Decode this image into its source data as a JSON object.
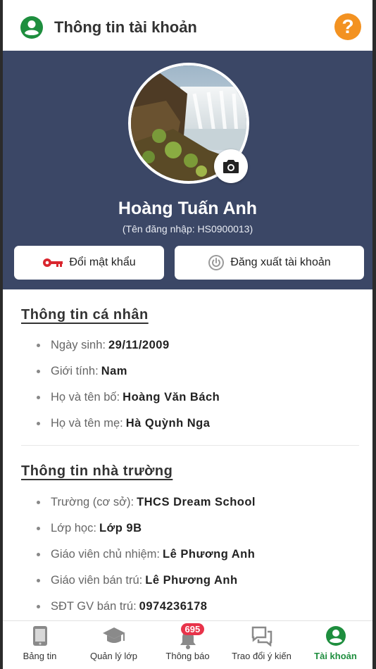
{
  "header": {
    "title": "Thông tin tài khoản",
    "help_symbol": "?",
    "icons": {
      "account": "account-circle-icon",
      "help": "help-icon"
    }
  },
  "profile": {
    "full_name": "Hoàng Tuấn Anh",
    "username_text": "(Tên đăng nhập: HS0900013)",
    "change_password_label": "Đổi mật khẩu",
    "logout_label": "Đăng xuất tài khoản",
    "icons": {
      "camera": "camera-icon",
      "key": "key-icon",
      "power": "power-icon"
    }
  },
  "personal": {
    "title": "Thông tin cá nhân",
    "items": [
      {
        "label": "Ngày sinh:",
        "value": "29/11/2009"
      },
      {
        "label": "Giới tính:",
        "value": "Nam"
      },
      {
        "label": "Họ và tên bố:",
        "value": "Hoàng Văn Bách"
      },
      {
        "label": "Họ và tên mẹ:",
        "value": "Hà Quỳnh Nga"
      }
    ]
  },
  "school": {
    "title": "Thông tin nhà trường",
    "items": [
      {
        "label": "Trường (cơ sở):",
        "value": "THCS Dream School"
      },
      {
        "label": "Lớp học:",
        "value": "Lớp 9B"
      },
      {
        "label": "Giáo viên chủ nhiệm:",
        "value": "Lê Phương Anh"
      },
      {
        "label": "Giáo viên bán trú:",
        "value": "Lê Phương Anh"
      },
      {
        "label": "SĐT GV bán trú:",
        "value": "0974236178"
      }
    ]
  },
  "nav": {
    "items": [
      {
        "label": "Bảng tin",
        "icon": "bulletin-icon"
      },
      {
        "label": "Quản lý lớp",
        "icon": "graduation-cap-icon"
      },
      {
        "label": "Thông báo",
        "icon": "bell-icon",
        "badge": "695"
      },
      {
        "label": "Trao đổi ý kiến",
        "icon": "chat-icon"
      },
      {
        "label": "Tài khoản",
        "icon": "account-icon",
        "active": true
      }
    ]
  },
  "colors": {
    "profile_bg": "#3b4766",
    "accent_green": "#1e8e3e",
    "help_orange": "#f39221",
    "key_red": "#d9262e",
    "badge_red": "#e8334a"
  }
}
